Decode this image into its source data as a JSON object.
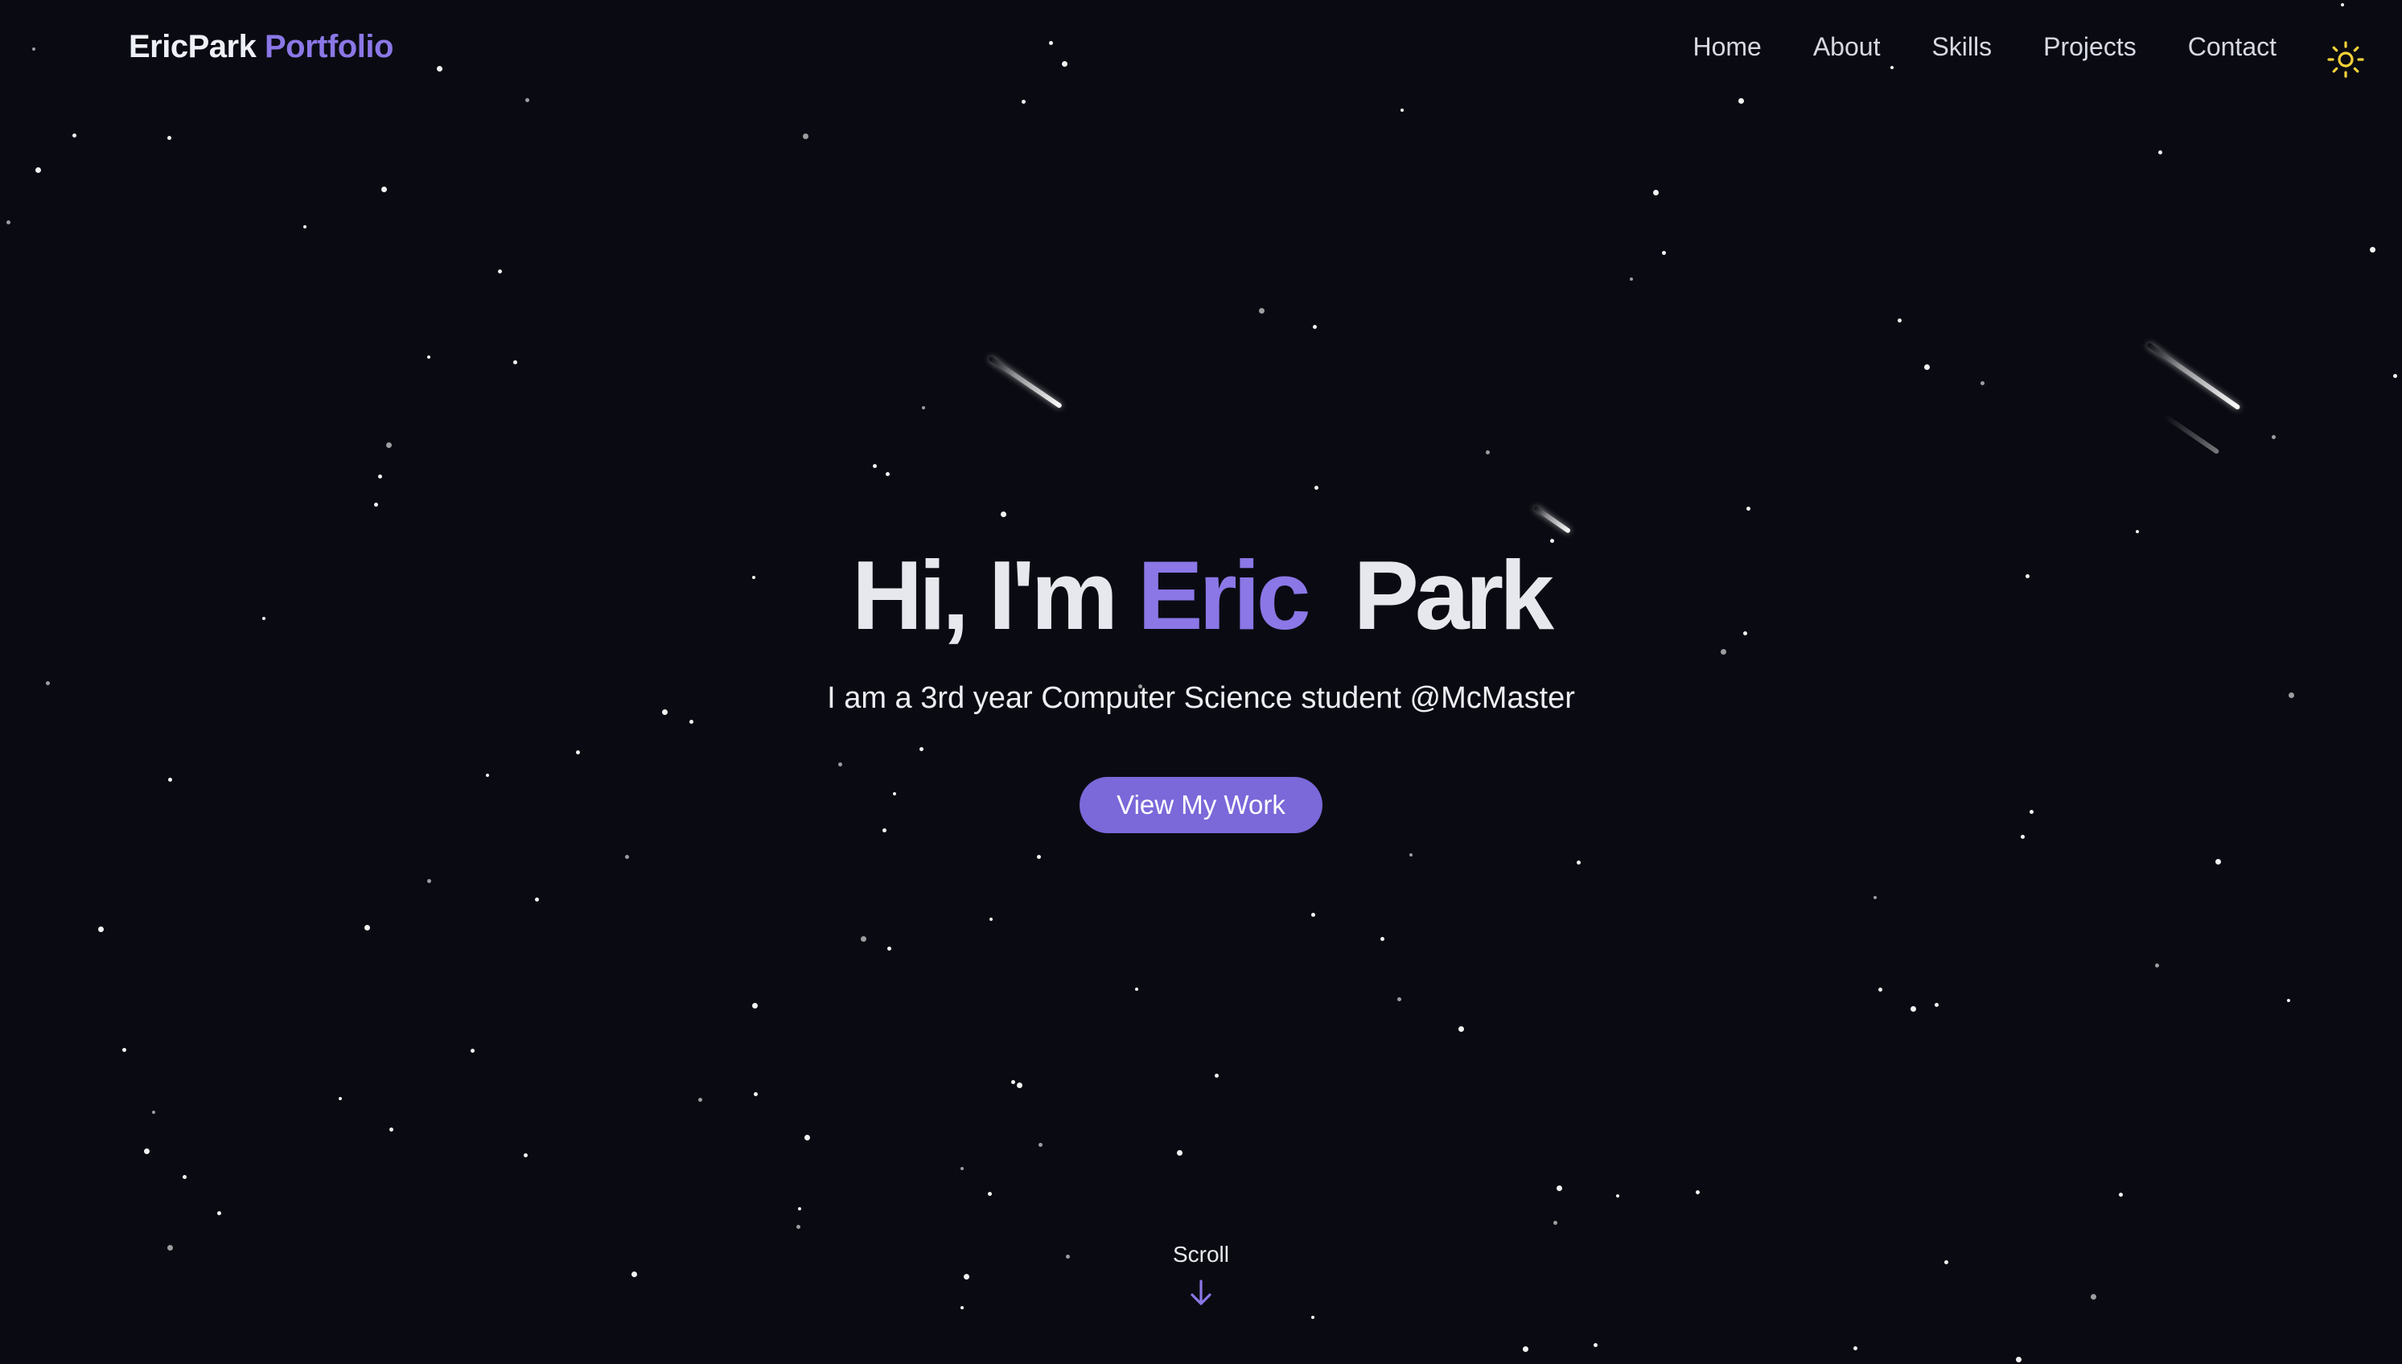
{
  "brand": {
    "name": "EricPark",
    "accent_word": "Portfolio",
    "accent_color": "#8b77e6"
  },
  "nav": {
    "links": [
      {
        "label": "Home"
      },
      {
        "label": "About"
      },
      {
        "label": "Skills"
      },
      {
        "label": "Projects"
      },
      {
        "label": "Contact"
      }
    ],
    "theme_toggle_icon": "sun-icon"
  },
  "hero": {
    "greeting": "Hi, I'm",
    "first_name": "Eric",
    "last_name": "Park",
    "subtitle": "I am a 3rd year Computer Science student @McMaster",
    "cta_label": "View My Work"
  },
  "scroll": {
    "label": "Scroll",
    "icon": "arrow-down-icon"
  },
  "colors": {
    "background": "#0a0b12",
    "accent": "#8b77e6",
    "button": "#7b68d9",
    "sun": "#f5d33a"
  }
}
